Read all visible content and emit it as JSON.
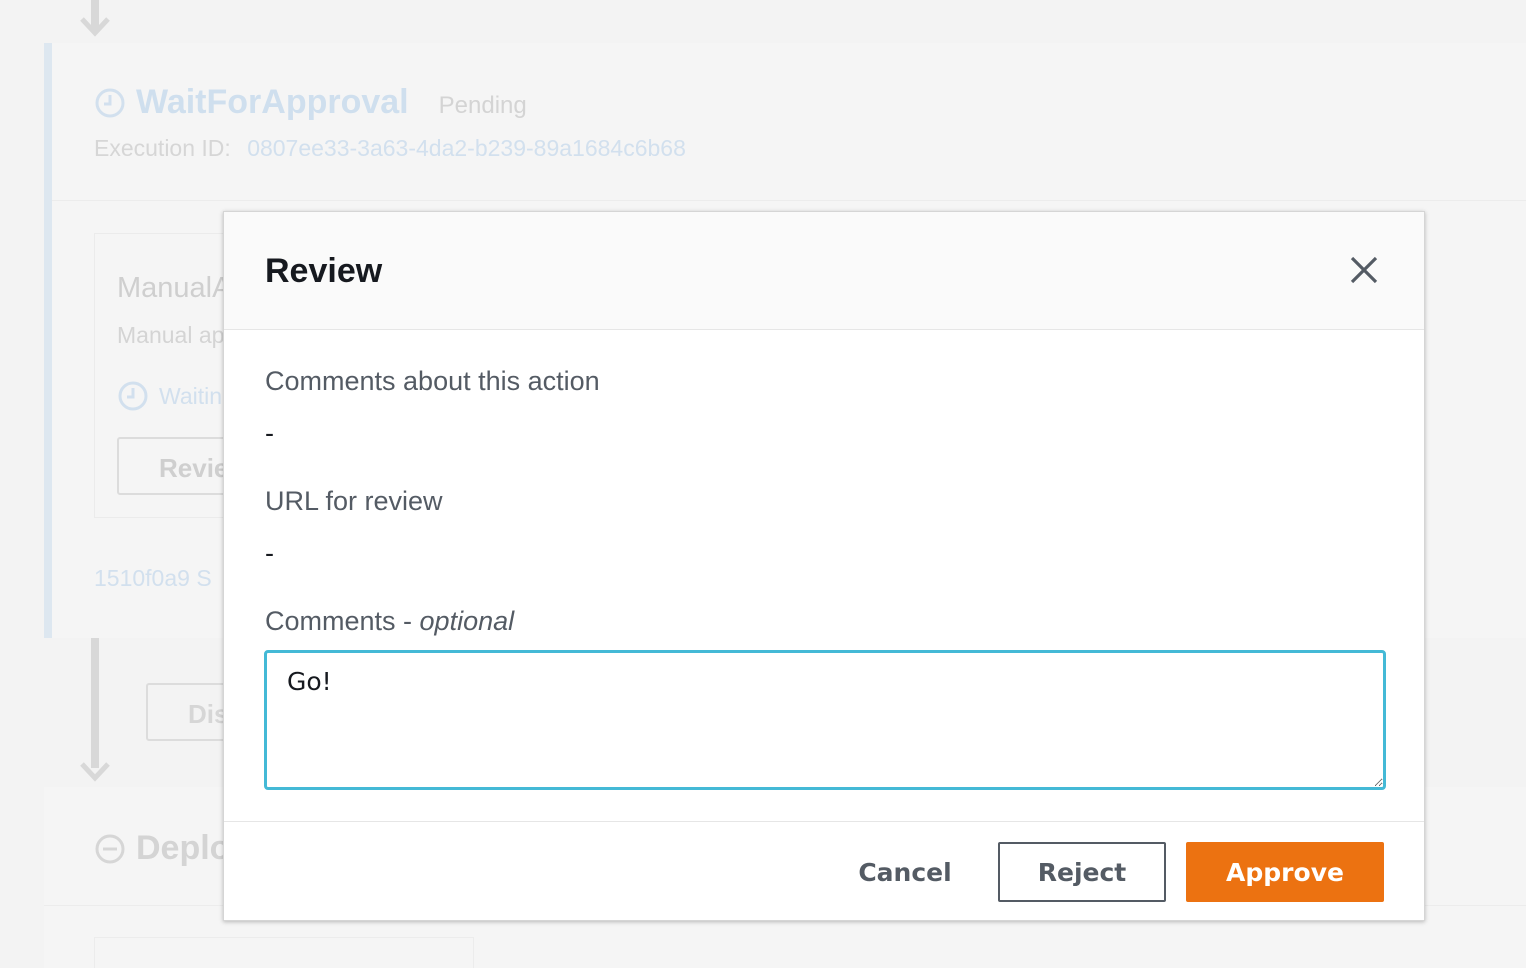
{
  "background": {
    "stage": {
      "title": "WaitForApproval",
      "status": "Pending",
      "execution_label": "Execution ID:",
      "execution_id": "0807ee33-3a63-4da2-b239-89a1684c6b68"
    },
    "action": {
      "name": "ManualA",
      "description": "Manual ap",
      "status": "Waitin",
      "review_button": "Revie"
    },
    "commit_text": "1510f0a9  S",
    "disable_button": "Dis",
    "next_stage_title": "Deplo"
  },
  "modal": {
    "title": "Review",
    "comments_about_label": "Comments about this action",
    "comments_about_value": "-",
    "url_label": "URL for review",
    "url_value": "-",
    "comments_label": "Comments - ",
    "comments_optional": "optional",
    "comments_value": "Go!",
    "cancel_label": "Cancel",
    "reject_label": "Reject",
    "approve_label": "Approve"
  },
  "colors": {
    "accent": "#ec7211",
    "focus": "#44b9d6",
    "text_primary": "#16191f",
    "text_secondary": "#545b64"
  },
  "icons": [
    "arrow-down-icon",
    "clock-icon",
    "close-icon",
    "minus-circle-icon"
  ]
}
